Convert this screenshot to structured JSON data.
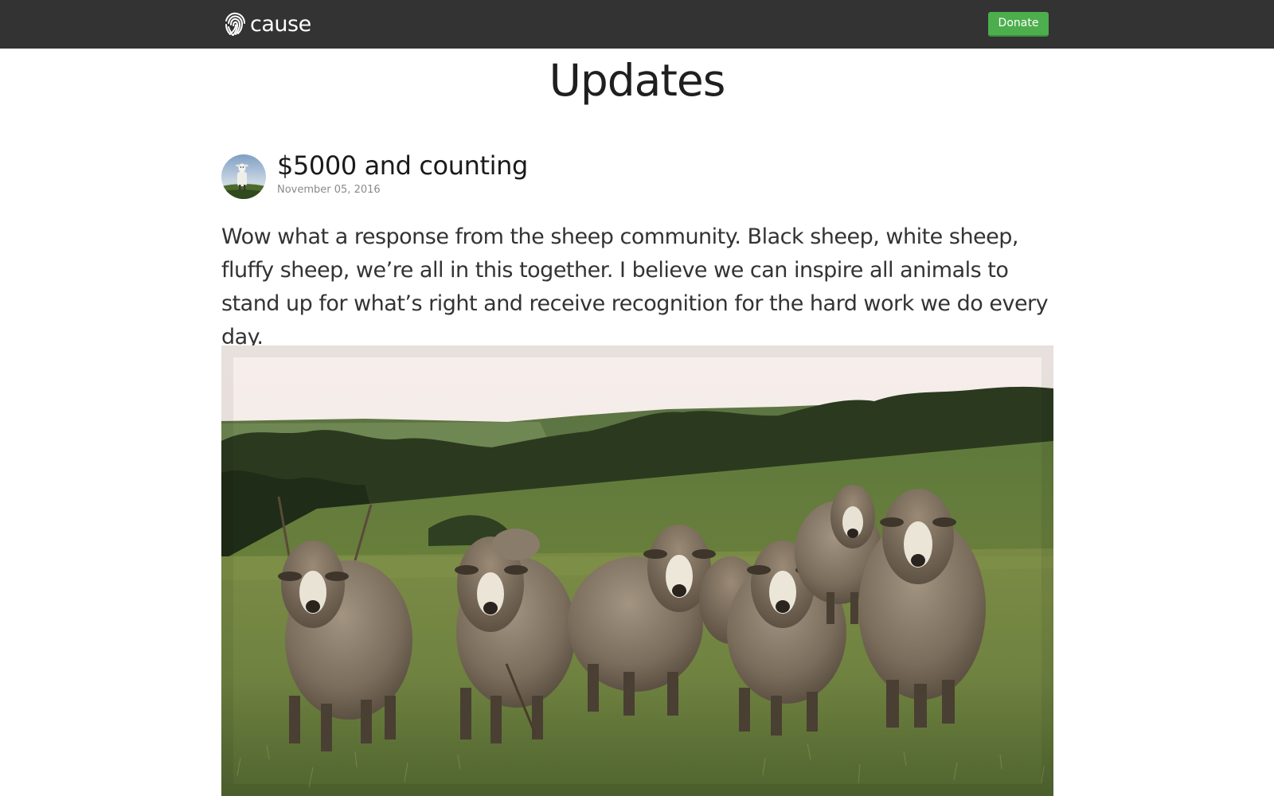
{
  "navbar": {
    "brand_name": "cause",
    "brand_icon": "fingerprint-icon",
    "donate_label": "Donate",
    "background_color": "#333333",
    "donate_color": "#4cae4c"
  },
  "page": {
    "title": "Updates"
  },
  "post": {
    "avatar_icon": "sheep-avatar",
    "title": "$5000 and counting",
    "date": "November 05, 2016",
    "body": "Wow what a response from the sheep community. Black sheep, white sheep, fluffy sheep, we’re all in this together. I believe we can inspire all animals to stand up for what’s right and receive recognition for the hard work we do every day.",
    "photo_subject": "flock-of-sheep-in-field"
  }
}
